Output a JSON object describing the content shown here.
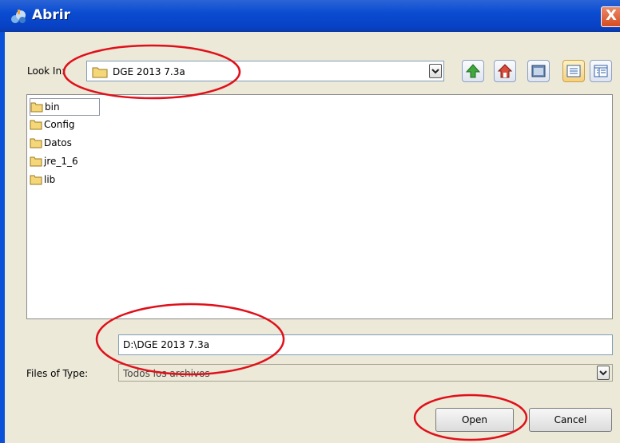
{
  "window": {
    "title": "Abrir",
    "close_label": "X"
  },
  "look_in": {
    "label": "Look In:",
    "value": "DGE 2013 7.3a"
  },
  "toolbar": [
    {
      "icon": "up-folder-icon"
    },
    {
      "icon": "home-icon"
    },
    {
      "icon": "new-folder-icon"
    },
    {
      "icon": "list-view-icon"
    },
    {
      "icon": "details-view-icon"
    }
  ],
  "files": [
    {
      "name": "bin",
      "selected": true
    },
    {
      "name": "Config"
    },
    {
      "name": "Datos"
    },
    {
      "name": "jre_1_6"
    },
    {
      "name": "lib"
    }
  ],
  "file_name": {
    "value": "D:\\DGE 2013 7.3a"
  },
  "file_type": {
    "label": "Files of Type:",
    "value": "Todos los archivos"
  },
  "buttons": {
    "open": "Open",
    "cancel": "Cancel"
  },
  "colors": {
    "titlebar": "#0a4cd1",
    "dialog_bg": "#ece9d8",
    "annotation": "#e0101a",
    "folder": "#f5d77a"
  }
}
